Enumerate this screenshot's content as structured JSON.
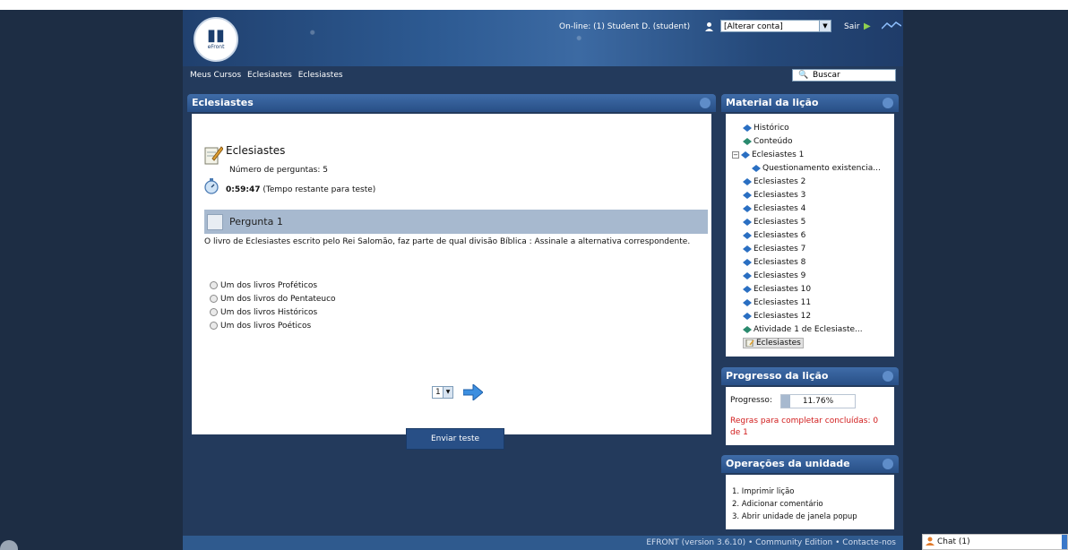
{
  "header": {
    "logo_text": "eFront",
    "online_text": "On-line: (1) Student D. (student)",
    "account_select": "[Alterar conta]",
    "logout_label": "Sair",
    "search_label": "Buscar"
  },
  "breadcrumb": [
    "Meus Cursos",
    "Eclesiastes",
    "Eclesiastes"
  ],
  "main": {
    "panel_title": "Eclesiastes",
    "test_title": "Eclesiastes",
    "num_questions": "Número de perguntas: 5",
    "time_value": "0:59:47",
    "time_suffix": "(Tempo restante para teste)",
    "question_title": "Pergunta 1",
    "question_text": "O livro de Eclesiastes escrito pelo Rei Salomão, faz parte de qual divisão Bíblica : Assinale a alternativa correspondente.",
    "options": [
      "Um dos livros Proféticos",
      "Um dos livros do Pentateuco",
      "Um dos livros Históricos",
      "Um dos livros Poéticos"
    ],
    "page_select": "1",
    "submit_label": "Enviar teste"
  },
  "material": {
    "title": "Material da lição",
    "items": [
      "Histórico",
      "Conteúdo",
      "Eclesiastes 1",
      "Questionamento existencia...",
      "Eclesiastes 2",
      "Eclesiastes 3",
      "Eclesiastes 4",
      "Eclesiastes 5",
      "Eclesiastes 6",
      "Eclesiastes 7",
      "Eclesiastes 8",
      "Eclesiastes 9",
      "Eclesiastes 10",
      "Eclesiastes 11",
      "Eclesiastes 12",
      "Atividade 1 de Eclesiaste...",
      "Eclesiastes"
    ]
  },
  "progress": {
    "title": "Progresso da lição",
    "label": "Progresso:",
    "value_text": "11.76%",
    "value_fraction": 0.1176,
    "rules": "Regras para completar concluídas: 0 de 1"
  },
  "operations": {
    "title": "Operações da unidade",
    "items": [
      "1. Imprimir lição",
      "2. Adicionar comentário",
      "3. Abrir unidade de janela popup"
    ]
  },
  "footer": {
    "text": "EFRONT (version 3.6.10) • Community Edition • Contacte-nos"
  },
  "chat": {
    "label": "Chat (1)"
  }
}
